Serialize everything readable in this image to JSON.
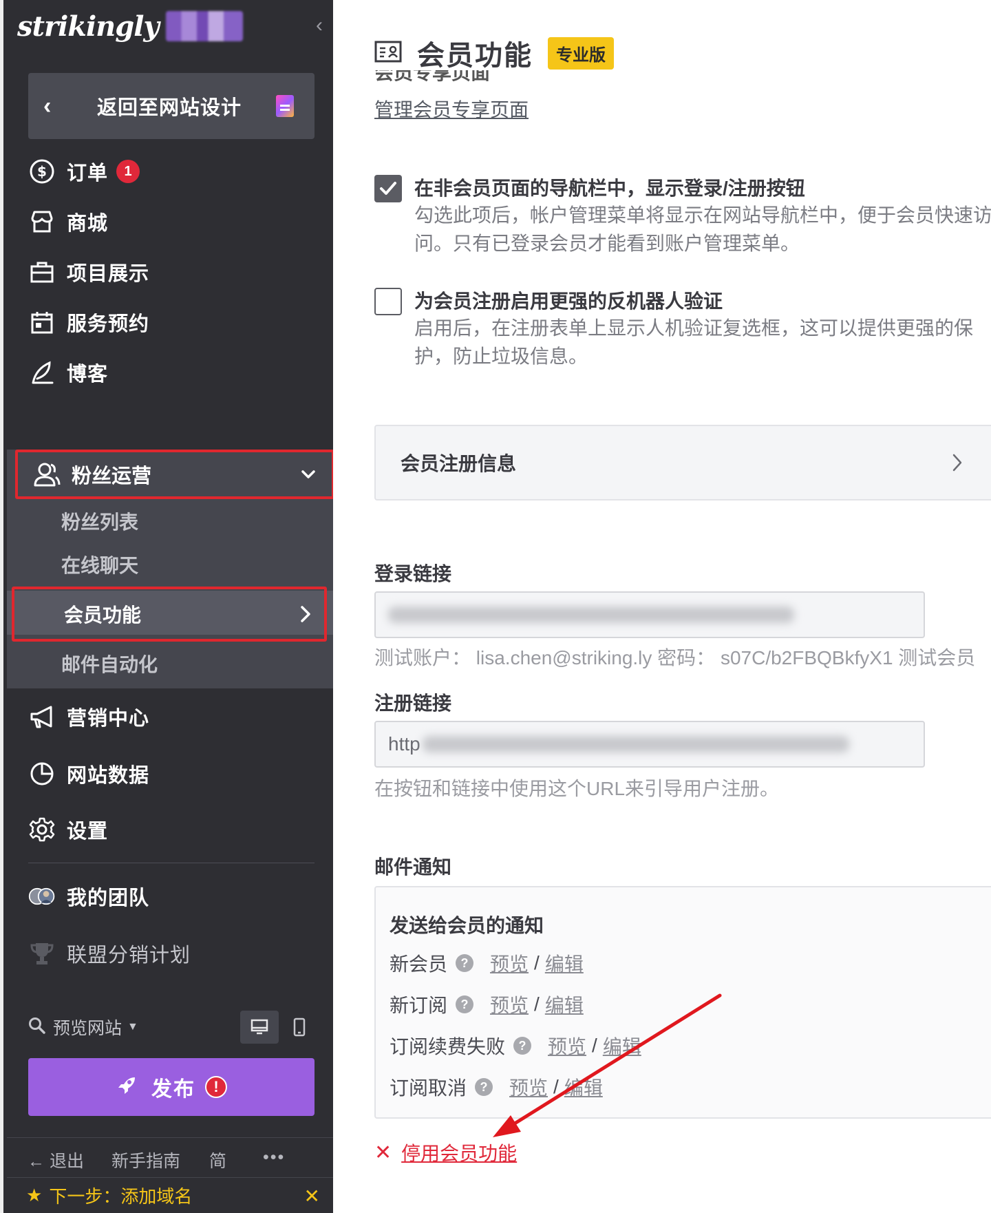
{
  "sidebar": {
    "logo": "strikingly",
    "back_label": "返回至网站设计",
    "items": [
      {
        "label": "订单",
        "icon": "dollar-circle-icon",
        "badge": "1"
      },
      {
        "label": "商城",
        "icon": "store-icon"
      },
      {
        "label": "项目展示",
        "icon": "briefcase-icon"
      },
      {
        "label": "服务预约",
        "icon": "calendar-icon"
      },
      {
        "label": "博客",
        "icon": "feather-pen-icon"
      }
    ],
    "fans": {
      "label": "粉丝运营",
      "icon": "users-icon",
      "sub_items": [
        "粉丝列表",
        "在线聊天",
        "会员功能",
        "邮件自动化"
      ]
    },
    "lower_items": [
      {
        "label": "营销中心",
        "icon": "megaphone-icon"
      },
      {
        "label": "网站数据",
        "icon": "pie-chart-icon"
      },
      {
        "label": "设置",
        "icon": "gear-icon"
      }
    ],
    "team_label": "我的团队",
    "affiliate_label": "联盟分销计划",
    "preview_label": "预览网站",
    "publish_label": "发布",
    "publish_alert": "!",
    "footer": {
      "logout": "退出",
      "guide": "新手指南",
      "lang": "简",
      "more": "•••"
    },
    "next_step": "下一步：添加域名",
    "accent": "#9a5fe0"
  },
  "main": {
    "title": "会员功能",
    "badge": "专业版",
    "cut_heading": "会员专享页面",
    "manage_link": "管理会员专享页面",
    "option1": {
      "title": "在非会员页面的导航栏中，显示登录/注册按钮",
      "desc": "勾选此项后，帐户管理菜单将显示在网站导航栏中，便于会员快速访问。只有已登录会员才能看到账户管理菜单。",
      "checked": true
    },
    "option2": {
      "title": "为会员注册启用更强的反机器人验证",
      "desc": "启用后，在注册表单上显示人机验证复选框，这可以提供更强的保护，防止垃圾信息。",
      "checked": false
    },
    "reg_info_label": "会员注册信息",
    "login_link_label": "登录链接",
    "login_hint": "测试账户： lisa.chen@striking.ly   密码： s07C/b2FBQBkfyX1   测试会员",
    "register_link_label": "注册链接",
    "register_link_value": "http",
    "register_hint": "在按钮和链接中使用这个URL来引导用户注册。",
    "email_label": "邮件通知",
    "notif_title": "发送给会员的通知",
    "notifications": [
      {
        "name": "新会员",
        "preview": "预览",
        "edit": "编辑"
      },
      {
        "name": "新订阅",
        "preview": "预览",
        "edit": "编辑"
      },
      {
        "name": "订阅续费失败",
        "preview": "预览",
        "edit": "编辑"
      },
      {
        "name": "订阅取消",
        "preview": "预览",
        "edit": "编辑"
      }
    ],
    "disable_label": "停用会员功能",
    "separator": "/",
    "help_glyph": "?"
  },
  "colors": {
    "highlight": "#e0272e",
    "pro_badge": "#f5c518",
    "sidebar_bg": "#2e2e33"
  }
}
